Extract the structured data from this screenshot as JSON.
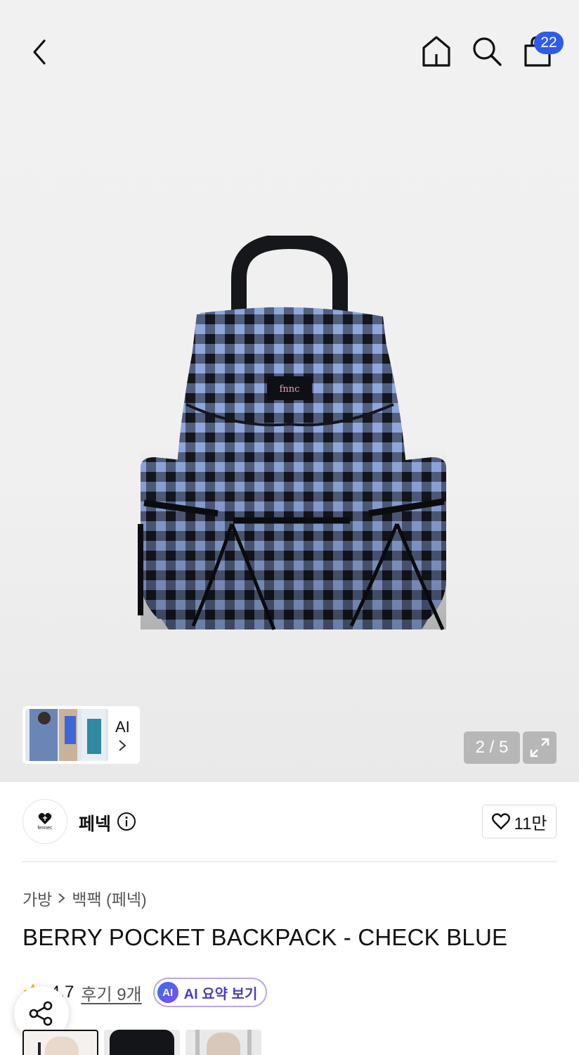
{
  "header": {
    "back_icon": "chevron-left-icon",
    "home_icon": "home-icon",
    "search_icon": "search-icon",
    "cart_icon": "shopping-bag-icon",
    "cart_count": "22"
  },
  "gallery": {
    "ai_label": "AI",
    "counter": "2 / 5",
    "expand_icon": "expand-icon"
  },
  "brand": {
    "logo_text": "fennec",
    "name": "페넥",
    "info_icon": "info-icon",
    "like_icon": "heart-outline-icon",
    "like_count": "11만"
  },
  "breadcrumb": {
    "items": [
      "가방",
      "백팩 (페넥)"
    ],
    "separator": ">"
  },
  "product": {
    "title": "BERRY POCKET BACKPACK - CHECK BLUE",
    "rating": "4.7",
    "reviews": "후기 9개",
    "ai_badge": "AI",
    "ai_summary": "AI 요약 보기"
  },
  "colors": {
    "accent": "#2f5bea",
    "ai_border": "#b9a6ef"
  }
}
